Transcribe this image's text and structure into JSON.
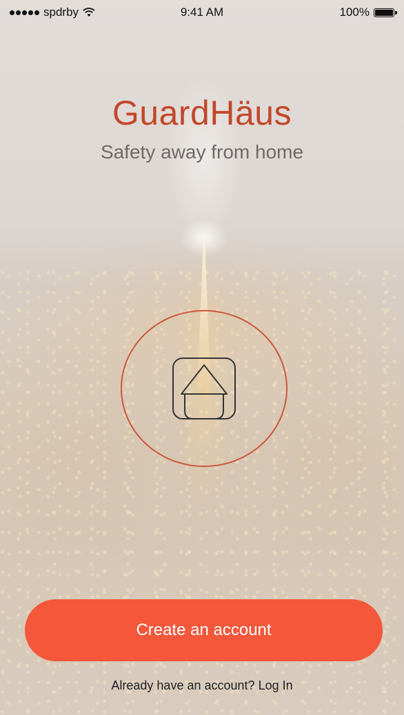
{
  "status_bar": {
    "carrier": "spdrby",
    "time": "9:41 AM",
    "battery": "100%"
  },
  "header": {
    "title": "GuardHäus",
    "subtitle": "Safety away from home"
  },
  "logo": {
    "icon": "house-icon"
  },
  "actions": {
    "create_account_label": "Create an account",
    "login_prompt": "Already have an account?",
    "login_link": "Log In"
  },
  "colors": {
    "brand": "#c2472a",
    "button": "#f4573a",
    "ring": "#c9573c"
  }
}
